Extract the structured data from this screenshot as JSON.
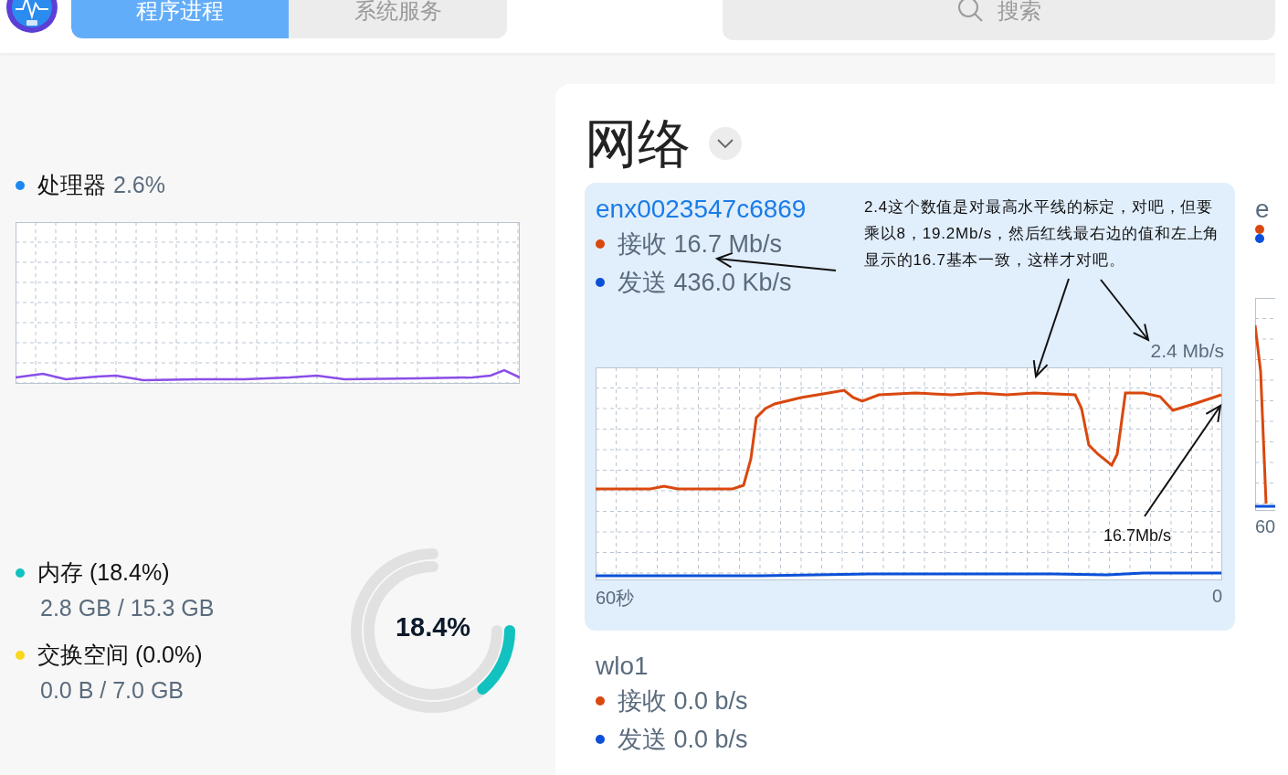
{
  "tabs": [
    {
      "label": "程序进程",
      "selected": true
    },
    {
      "label": "系统服务",
      "selected": false
    }
  ],
  "search": {
    "placeholder": "搜索"
  },
  "cpu": {
    "label": "处理器",
    "reading": "2.6%",
    "color": "#1a88f0"
  },
  "memory": [
    {
      "label": "内存 (18.4%)",
      "usage": "2.8 GB / 15.3 GB",
      "color": "#12c2c0"
    },
    {
      "label": "交换空间 (0.0%)",
      "usage": "0.0 B / 7.0 GB",
      "color": "#f8d81c"
    }
  ],
  "gauge": {
    "reading": "18.4%",
    "level": 0.184
  },
  "network": {
    "title": "网络",
    "interfaces": [
      {
        "name": "enx0023547c6869",
        "selected": true,
        "rows": [
          {
            "label": "接收 16.7 Mb/s",
            "color": "#d9480f"
          },
          {
            "label": "发送 436.0 Kb/s",
            "color": "#0b50d8"
          }
        ],
        "scale": "2.4 Mb/s",
        "x_start": "60秒",
        "x_end": "0"
      },
      {
        "name": "e",
        "selected": false,
        "rows": [
          {
            "color": "#d9480f"
          },
          {
            "color": "#0b50d8"
          }
        ],
        "x_start": "60"
      },
      {
        "name": "wlo1",
        "selected": false,
        "rows": [
          {
            "label": "接收 0.0 b/s",
            "color": "#d9480f"
          },
          {
            "label": "发送 0.0 b/s",
            "color": "#0b50d8"
          }
        ]
      }
    ]
  },
  "annotations": [
    {
      "text": "2.4这个数值是对最高水平线的标定，对吧，但要乘以8，19.2Mb/s，然后红线最右边的值和左上角显示的16.7基本一致，这样才对吧。"
    },
    {
      "text": "16.7Mb/s"
    }
  ]
}
